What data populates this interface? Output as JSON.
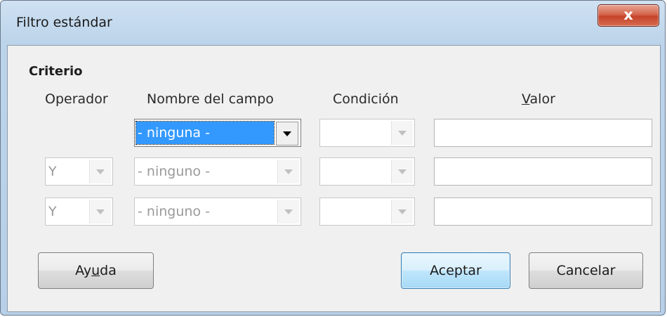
{
  "window": {
    "title": "Filtro estándar",
    "close_glyph": "x"
  },
  "criteria": {
    "section_label": "Criterio",
    "headers": {
      "operator": "Operador",
      "field": "Nombre del campo",
      "condition": "Condición",
      "value_pre": "",
      "value_mnemonic": "V",
      "value_post": "alor"
    },
    "rows": [
      {
        "operator": "",
        "field": "- ninguna -",
        "condition": "",
        "value": ""
      },
      {
        "operator": "Y",
        "field": "- ninguno -",
        "condition": "",
        "value": ""
      },
      {
        "operator": "Y",
        "field": "- ninguno -",
        "condition": "",
        "value": ""
      }
    ]
  },
  "buttons": {
    "help_pre": "Ay",
    "help_mnemonic": "u",
    "help_post": "da",
    "ok": "Aceptar",
    "cancel": "Cancelar"
  },
  "colors": {
    "selection": "#3399ff",
    "title_bar": "#bcd4ea",
    "close_button": "#c4432a"
  }
}
